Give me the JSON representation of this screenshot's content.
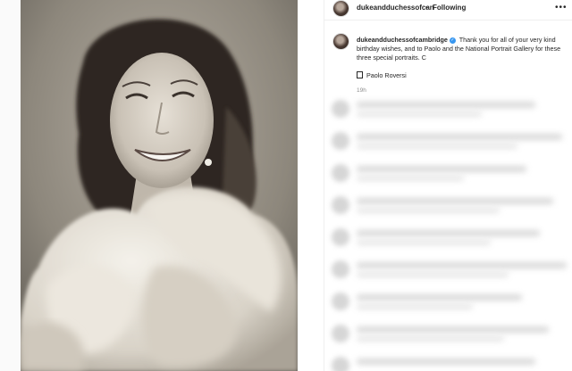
{
  "post": {
    "header": {
      "handle": "dukeandduchessofcan",
      "separator": "•",
      "follow_label": "Following",
      "more_label": "•••"
    },
    "caption": {
      "handle": "dukeandduchessofcambridge",
      "verified_mark": "✓",
      "text": "Thank you for all of your very kind birthday wishes, and to Paolo and the National Portrait Gallery for these three special portraits. C",
      "credit": "Paolo Roversi",
      "timestamp": "19h"
    },
    "photo_description_icon": "portrait-photo",
    "comments_blurred_count": 9
  }
}
